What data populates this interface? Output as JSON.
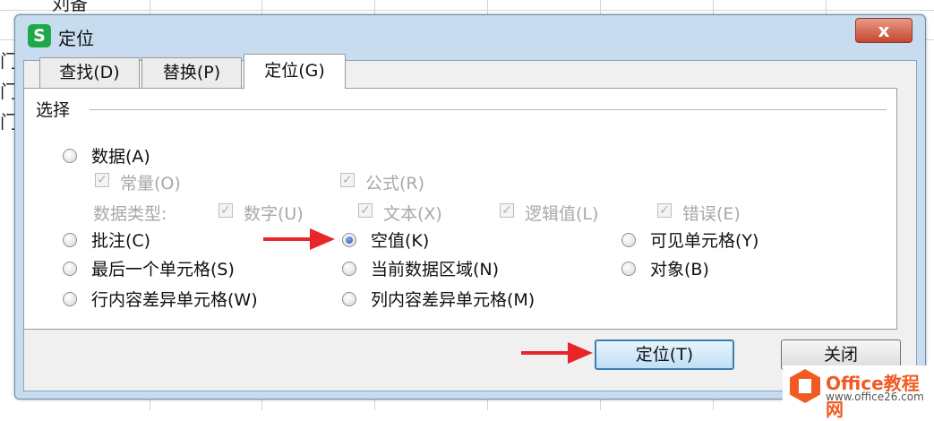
{
  "background": {
    "cell_text_top": "刘备",
    "cell_fragments": [
      "门",
      "门",
      "门"
    ]
  },
  "dialog": {
    "app_icon": "S",
    "title": "定位",
    "close_label": "x",
    "tabs": [
      {
        "label": "查找(D)",
        "active": false
      },
      {
        "label": "替换(P)",
        "active": false
      },
      {
        "label": "定位(G)",
        "active": true
      }
    ],
    "group_label": "选择",
    "options": {
      "data": {
        "label": "数据(A)",
        "checked": false
      },
      "constant": {
        "label": "常量(O)",
        "checked": true,
        "enabled": false
      },
      "formula": {
        "label": "公式(R)",
        "checked": true,
        "enabled": false
      },
      "data_type_label": "数据类型:",
      "number": {
        "label": "数字(U)",
        "checked": true,
        "enabled": false
      },
      "text": {
        "label": "文本(X)",
        "checked": true,
        "enabled": false
      },
      "logical": {
        "label": "逻辑值(L)",
        "checked": true,
        "enabled": false
      },
      "error": {
        "label": "错误(E)",
        "checked": true,
        "enabled": false
      },
      "comment": {
        "label": "批注(C)",
        "checked": false
      },
      "blank": {
        "label": "空值(K)",
        "checked": true
      },
      "visible_cells": {
        "label": "可见单元格(Y)",
        "checked": false
      },
      "last_cell": {
        "label": "最后一个单元格(S)",
        "checked": false
      },
      "current_region": {
        "label": "当前数据区域(N)",
        "checked": false
      },
      "objects": {
        "label": "对象(B)",
        "checked": false
      },
      "row_differences": {
        "label": "行内容差异单元格(W)",
        "checked": false
      },
      "column_differences": {
        "label": "列内容差异单元格(M)",
        "checked": false
      }
    },
    "buttons": {
      "locate": "定位(T)",
      "close": "关闭"
    }
  },
  "annotation_color": "#e8262a",
  "watermark": {
    "name": "Office教程网",
    "url": "www.office26.com"
  }
}
